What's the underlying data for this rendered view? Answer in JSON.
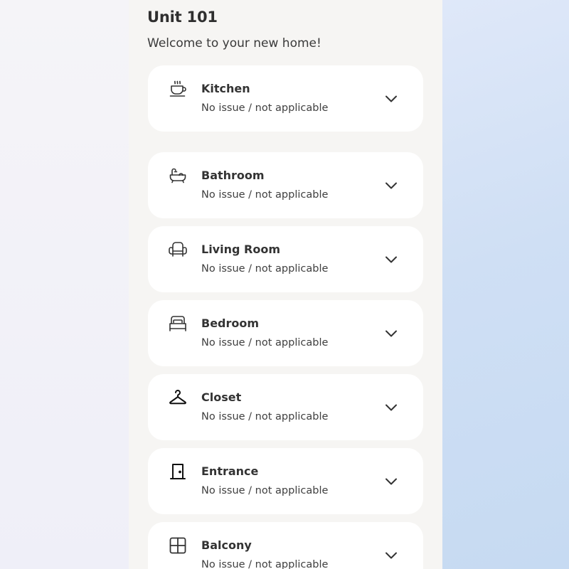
{
  "header": {
    "title": "Unit 101",
    "subtitle": "Welcome to your new home!"
  },
  "colors": {
    "panel_background": "#f6f5f3",
    "card_background": "#ffffff",
    "text_primary": "#333333",
    "right_background": "#c6daf2"
  },
  "rooms": [
    {
      "name": "Kitchen",
      "status": "No issue / not applicable",
      "icon": "coffee-cup-icon"
    },
    {
      "name": "Bathroom",
      "status": "No issue / not applicable",
      "icon": "bathtub-icon"
    },
    {
      "name": "Living Room",
      "status": "No issue / not applicable",
      "icon": "armchair-icon"
    },
    {
      "name": "Bedroom",
      "status": "No issue / not applicable",
      "icon": "bed-icon"
    },
    {
      "name": "Closet",
      "status": "No issue / not applicable",
      "icon": "hanger-icon"
    },
    {
      "name": "Entrance",
      "status": "No issue / not applicable",
      "icon": "door-icon"
    },
    {
      "name": "Balcony",
      "status": "No issue / not applicable",
      "icon": "window-icon"
    }
  ]
}
